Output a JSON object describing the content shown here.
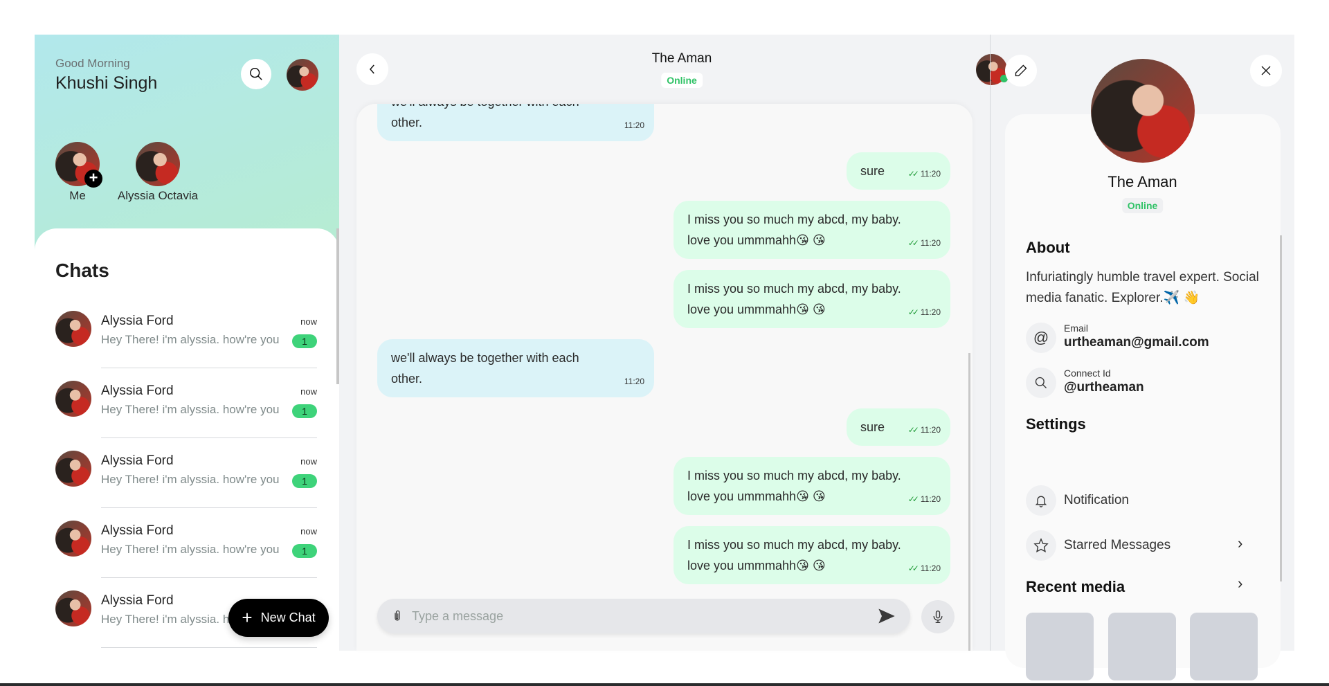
{
  "left": {
    "greeting": "Good Morning",
    "user_name": "Khushi Singh",
    "stories": [
      {
        "label": "Me",
        "add": true
      },
      {
        "label": "Alyssia Octavia",
        "add": false
      }
    ],
    "chats_title": "Chats",
    "chats": [
      {
        "name": "Alyssia Ford",
        "preview": "Hey There! i'm alyssia. how're you",
        "time": "now",
        "unread": "1"
      },
      {
        "name": "Alyssia Ford",
        "preview": "Hey There! i'm alyssia. how're you",
        "time": "now",
        "unread": "1"
      },
      {
        "name": "Alyssia Ford",
        "preview": "Hey There! i'm alyssia. how're you",
        "time": "now",
        "unread": "1"
      },
      {
        "name": "Alyssia Ford",
        "preview": "Hey There! i'm alyssia. how're you",
        "time": "now",
        "unread": "1"
      },
      {
        "name": "Alyssia Ford",
        "preview": "Hey There! i'm alyssia. how're you",
        "time": "",
        "unread": ""
      }
    ],
    "new_chat_label": "New Chat"
  },
  "chat": {
    "title": "The Aman",
    "status": "Online",
    "messages": [
      {
        "dir": "in",
        "text": "we'll always be together with each other.",
        "time": "11:20"
      },
      {
        "dir": "out",
        "text": "sure",
        "time": "11:20"
      },
      {
        "dir": "out",
        "text": "I miss you so much my abcd, my baby. love you ummmahh😘 😘",
        "time": "11:20"
      },
      {
        "dir": "out",
        "text": "I miss you so much my abcd, my baby. love you ummmahh😘 😘",
        "time": "11:20"
      },
      {
        "dir": "in",
        "text": "we'll always be together with each other.",
        "time": "11:20"
      },
      {
        "dir": "out",
        "text": "sure",
        "time": "11:20"
      },
      {
        "dir": "out",
        "text": "I miss you so much my abcd, my baby. love you ummmahh😘 😘",
        "time": "11:20"
      },
      {
        "dir": "out",
        "text": "I miss you so much my abcd, my baby. love you ummmahh😘 😘",
        "time": "11:20"
      }
    ],
    "input_placeholder": "Type a message",
    "input_value": ""
  },
  "profile": {
    "name": "The Aman",
    "status": "Online",
    "about_title": "About",
    "about_text": "Infuriatingly humble travel expert. Social media fanatic. Explorer.✈️ 👋",
    "email_label": "Email",
    "email_value": "urtheaman@gmail.com",
    "connect_label": "Connect Id",
    "connect_value": "@urtheaman",
    "settings_title": "Settings",
    "notification_label": "Notification",
    "starred_label": "Starred Messages",
    "recent_media_title": "Recent media",
    "media_count": 3
  },
  "colors": {
    "online": "#2fc266",
    "unread_badge": "#3ed37a",
    "incoming_bubble": "#dbf3f8",
    "outgoing_bubble": "#dcfde9",
    "read_tick": "#1e9a36"
  }
}
